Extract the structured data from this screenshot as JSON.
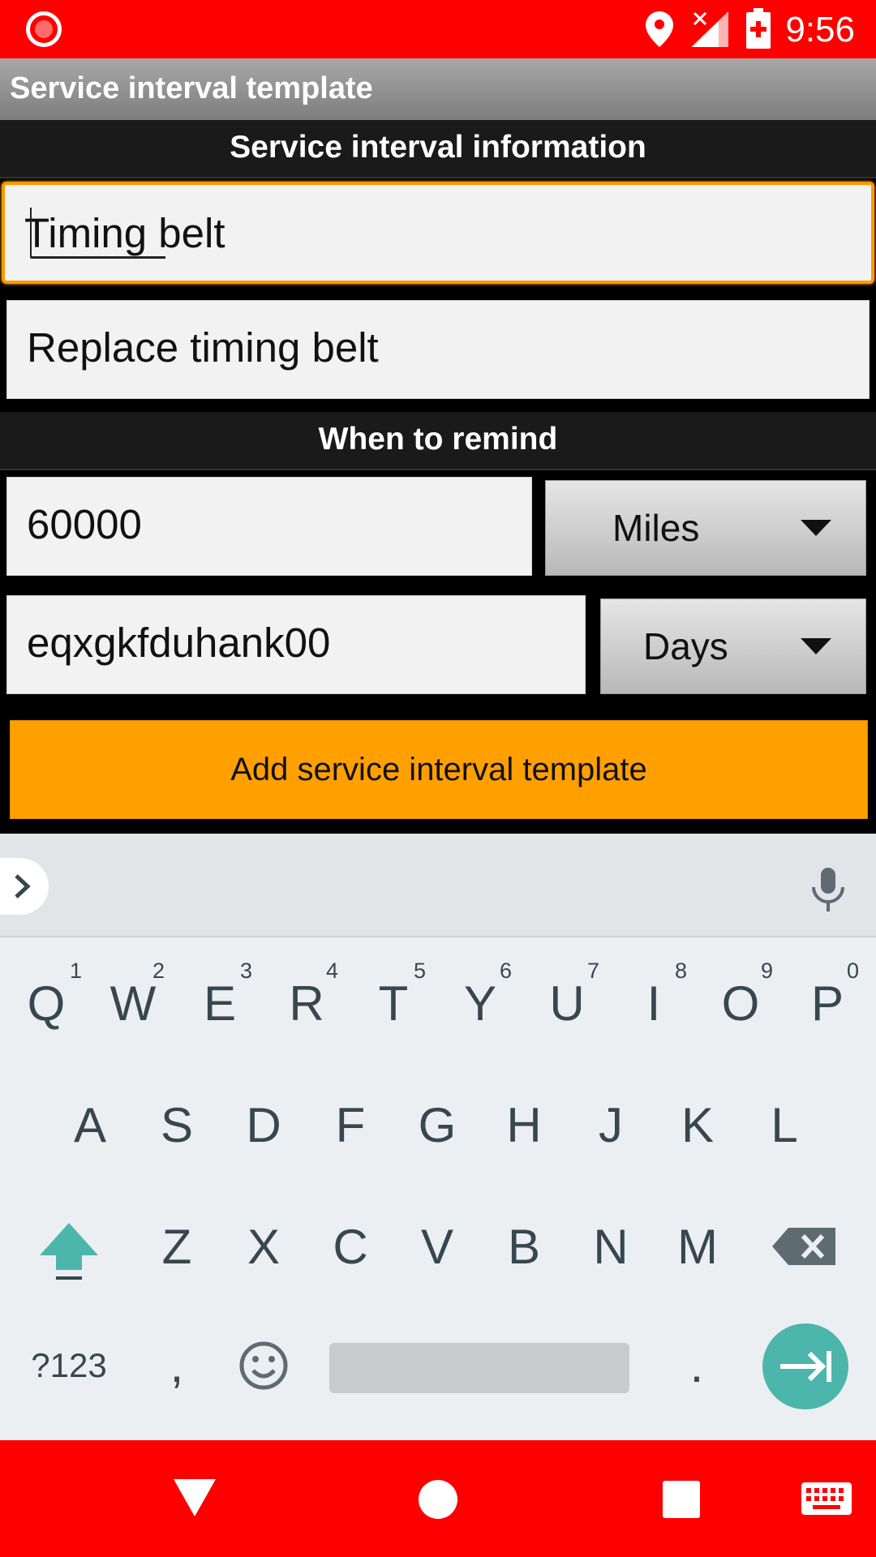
{
  "status_bar": {
    "time": "9:56"
  },
  "action_bar": {
    "title": "Service interval template"
  },
  "sections": {
    "info_header": "Service interval information",
    "remind_header": "When to remind"
  },
  "fields": {
    "name_value": "Timing belt",
    "description_value": "Replace timing belt",
    "distance_value": "60000",
    "time_value": "eqxgkfduhank00"
  },
  "spinners": {
    "distance_unit": "Miles",
    "time_unit": "Days"
  },
  "button": {
    "add_label": "Add service interval template"
  },
  "keyboard": {
    "row1": [
      "Q",
      "W",
      "E",
      "R",
      "T",
      "Y",
      "U",
      "I",
      "O",
      "P"
    ],
    "row1_hints": [
      "1",
      "2",
      "3",
      "4",
      "5",
      "6",
      "7",
      "8",
      "9",
      "0"
    ],
    "row2": [
      "A",
      "S",
      "D",
      "F",
      "G",
      "H",
      "J",
      "K",
      "L"
    ],
    "row3": [
      "Z",
      "X",
      "C",
      "V",
      "B",
      "N",
      "M"
    ],
    "symbols_label": "?123",
    "comma": ",",
    "period": ".",
    "accent_color": "#4db6ac"
  },
  "colors": {
    "status_bar": "#ff0000",
    "accent": "#ffa000",
    "focus_border": "#ff9800"
  },
  "icons": [
    "record-icon",
    "location-icon",
    "no-signal-icon",
    "battery-icon",
    "chevron-right-icon",
    "microphone-icon",
    "shift-icon",
    "backspace-icon",
    "emoji-icon",
    "enter-next-icon",
    "back-icon",
    "home-icon",
    "recents-icon",
    "keyboard-icon"
  ]
}
